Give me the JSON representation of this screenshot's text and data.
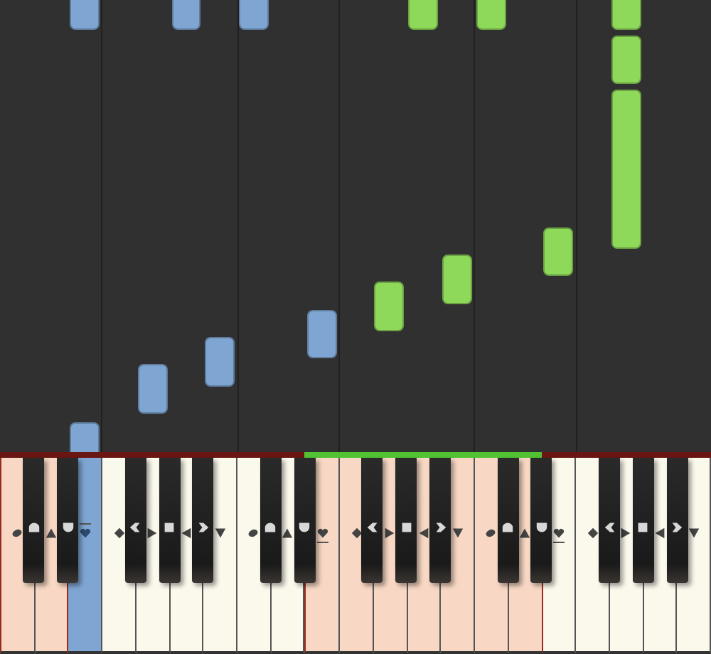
{
  "keyboard": {
    "white_keys": [
      {
        "tinted": true,
        "in_range": false,
        "pressed": false,
        "overline": false,
        "underline": false
      },
      {
        "tinted": true,
        "in_range": false,
        "pressed": false,
        "overline": false,
        "underline": false
      },
      {
        "tinted": false,
        "in_range": false,
        "pressed": true,
        "overline": true,
        "underline": false
      },
      {
        "tinted": false,
        "in_range": false,
        "pressed": false,
        "overline": false,
        "underline": false
      },
      {
        "tinted": false,
        "in_range": false,
        "pressed": false,
        "overline": false,
        "underline": false
      },
      {
        "tinted": false,
        "in_range": false,
        "pressed": false,
        "overline": false,
        "underline": false
      },
      {
        "tinted": false,
        "in_range": false,
        "pressed": false,
        "overline": false,
        "underline": false
      },
      {
        "tinted": false,
        "in_range": false,
        "pressed": false,
        "overline": false,
        "underline": false
      },
      {
        "tinted": false,
        "in_range": false,
        "pressed": false,
        "overline": false,
        "underline": false
      },
      {
        "tinted": true,
        "in_range": true,
        "pressed": false,
        "overline": false,
        "underline": true
      },
      {
        "tinted": true,
        "in_range": true,
        "pressed": false,
        "overline": false,
        "underline": false
      },
      {
        "tinted": true,
        "in_range": true,
        "pressed": false,
        "overline": false,
        "underline": false
      },
      {
        "tinted": true,
        "in_range": true,
        "pressed": false,
        "overline": false,
        "underline": false
      },
      {
        "tinted": true,
        "in_range": true,
        "pressed": false,
        "overline": false,
        "underline": false
      },
      {
        "tinted": true,
        "in_range": true,
        "pressed": false,
        "overline": false,
        "underline": false
      },
      {
        "tinted": true,
        "in_range": true,
        "pressed": false,
        "overline": false,
        "underline": false
      },
      {
        "tinted": false,
        "in_range": false,
        "pressed": false,
        "overline": false,
        "underline": true
      },
      {
        "tinted": false,
        "in_range": false,
        "pressed": false,
        "overline": false,
        "underline": false
      },
      {
        "tinted": false,
        "in_range": false,
        "pressed": false,
        "overline": false,
        "underline": false
      },
      {
        "tinted": false,
        "in_range": false,
        "pressed": false,
        "overline": false,
        "underline": false
      },
      {
        "tinted": false,
        "in_range": false,
        "pressed": false,
        "overline": false,
        "underline": false
      }
    ]
  }
}
